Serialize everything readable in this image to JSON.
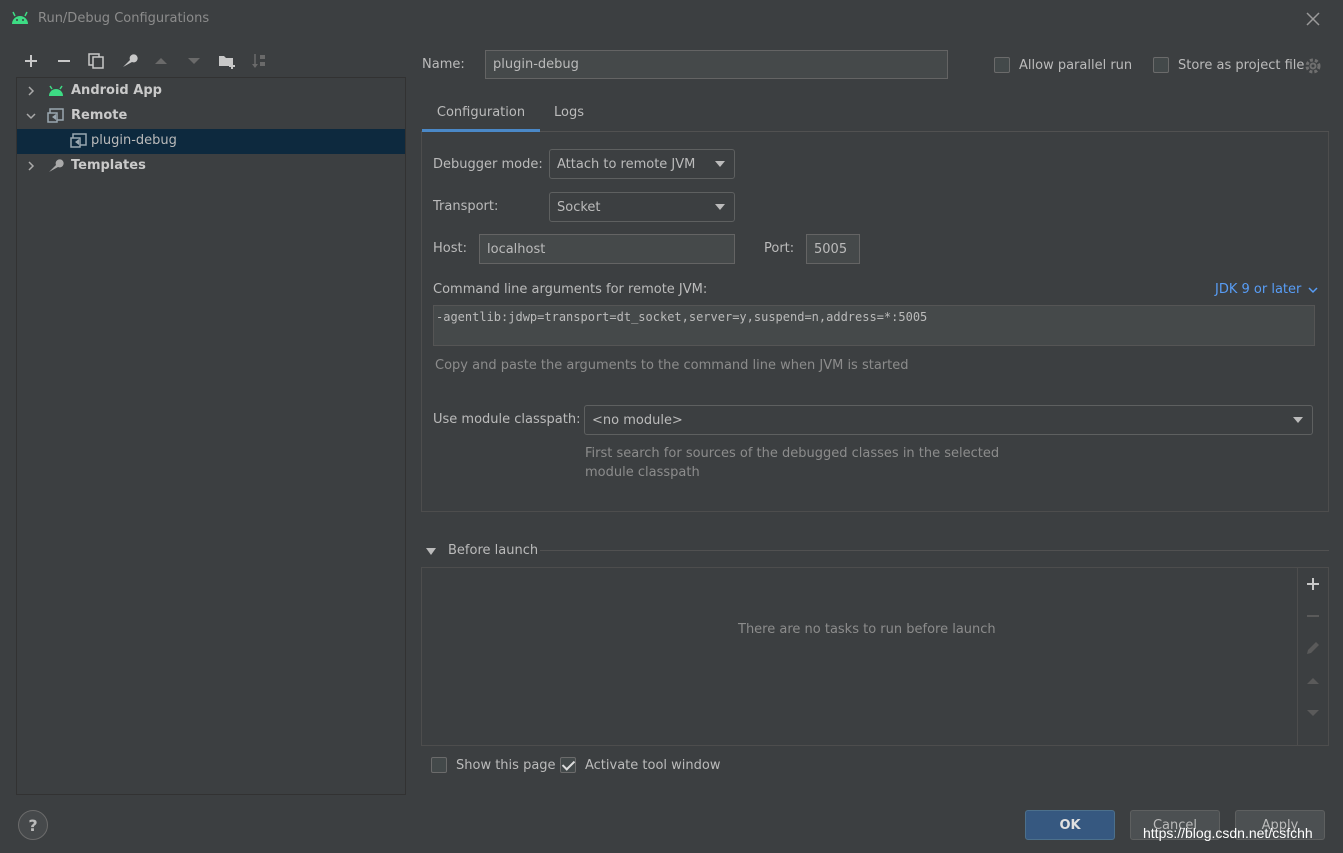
{
  "window": {
    "title": "Run/Debug Configurations"
  },
  "tree": {
    "items": [
      {
        "label": "Android App"
      },
      {
        "label": "Remote"
      },
      {
        "label": "plugin-debug"
      },
      {
        "label": "Templates"
      }
    ]
  },
  "form": {
    "name_label": "Name:",
    "name_value": "plugin-debug",
    "allow_parallel_label": "Allow parallel run",
    "store_project_label": "Store as project file",
    "tabs": [
      {
        "label": "Configuration"
      },
      {
        "label": "Logs"
      }
    ],
    "debugger_mode_label": "Debugger mode:",
    "debugger_mode_value": "Attach to remote JVM",
    "transport_label": "Transport:",
    "transport_value": "Socket",
    "host_label": "Host:",
    "host_value": "localhost",
    "port_label": "Port:",
    "port_value": "5005",
    "cmdline_label": "Command line arguments for remote JVM:",
    "jdk_link": "JDK 9 or later",
    "cmdline_value": "-agentlib:jdwp=transport=dt_socket,server=y,suspend=n,address=*:5005",
    "cmdline_hint": "Copy and paste the arguments to the command line when JVM is started",
    "module_label": "Use module classpath:",
    "module_value": "<no module>",
    "module_hint_1": "First search for sources of the debugged classes in the selected",
    "module_hint_2": "module classpath"
  },
  "before_launch": {
    "title": "Before launch",
    "empty_text": "There are no tasks to run before launch"
  },
  "footer": {
    "show_page_label": "Show this page",
    "show_page_checked": false,
    "activate_tool_label": "Activate tool window",
    "activate_tool_checked": true,
    "help_label": "?",
    "ok_label": "OK",
    "cancel_label": "Cancel",
    "apply_label": "Apply",
    "watermark": "https://blog.csdn.net/csfchh"
  },
  "colors": {
    "background": "#3c3f41",
    "selection": "#0d293e",
    "accent": "#4a88c7",
    "link": "#589df6",
    "android_green": "#3ddc84"
  }
}
